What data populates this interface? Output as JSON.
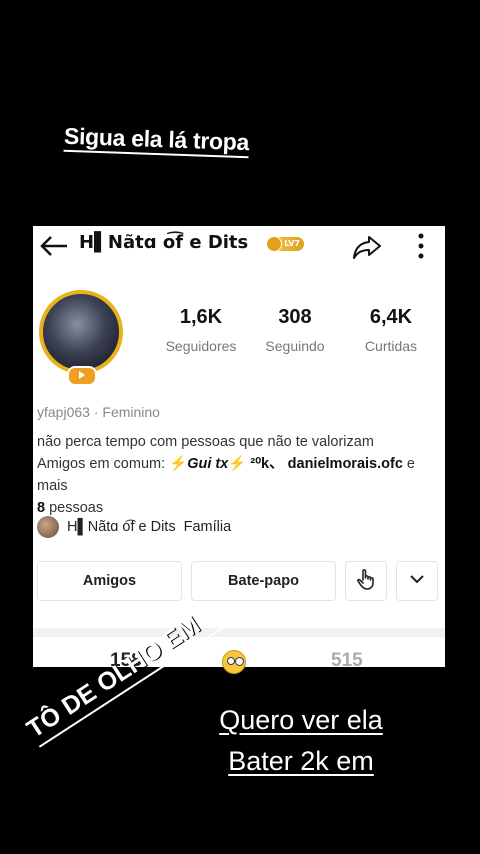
{
  "overlay": {
    "top_caption": "Sigua ela lá tropa",
    "diagonal_caption": "TÔ DE OLHO EM",
    "right_caption_line1": "Quero ver ela",
    "right_caption_line2": "Bater 2k em"
  },
  "profile": {
    "username": "H▌Nãtɑ o͡f e Dits",
    "level_badge": "LV7",
    "stats": [
      {
        "value": "1,6K",
        "label": "Seguidores"
      },
      {
        "value": "308",
        "label": "Seguindo"
      },
      {
        "value": "6,4K",
        "label": "Curtidas"
      }
    ],
    "handle": "yfapj063",
    "separator": "·",
    "gender": "Feminino",
    "bio_line1": "não perca tempo com pessoas que não te valorizam",
    "mutual_prefix": "Amigos em comum:",
    "mutual_bolt": "⚡",
    "mutual_name1": "Gui tx",
    "mutual_sup": "²⁰k、",
    "mutual_name2": "danielmorais.ofc",
    "mutual_more": "e mais",
    "mutual_count": "8",
    "mutual_suffix": "pessoas",
    "family_name": "H▌Nãtɑ o͡f e Dits",
    "family_label": "Família"
  },
  "buttons": {
    "friends": "Amigos",
    "chat": "Bate-papo"
  },
  "peek_counts": [
    "158",
    "515"
  ],
  "colors": {
    "accent_gold": "#e8b21c",
    "background": "#000000"
  }
}
